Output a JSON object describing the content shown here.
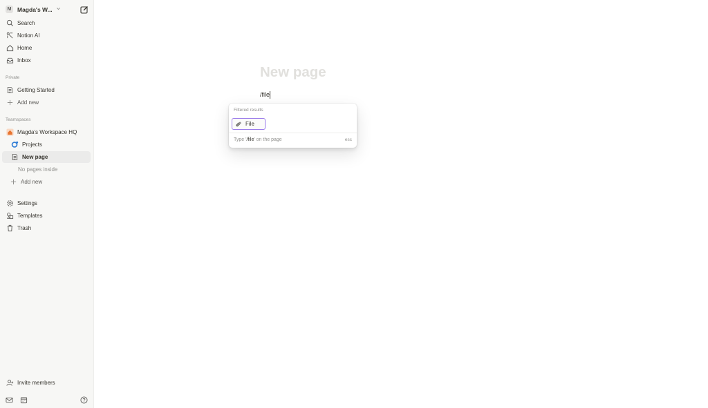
{
  "sidebar": {
    "workspace": {
      "badge": "M",
      "name": "Magda's W..."
    },
    "top_items": [
      {
        "label": "Search",
        "icon": "search-icon"
      },
      {
        "label": "Notion AI",
        "icon": "notion-ai-icon"
      },
      {
        "label": "Home",
        "icon": "home-icon"
      },
      {
        "label": "Inbox",
        "icon": "inbox-icon"
      }
    ],
    "private_label": "Private",
    "private_items": [
      {
        "label": "Getting Started",
        "icon": "page-icon"
      },
      {
        "label": "Add new",
        "icon": "plus-icon"
      }
    ],
    "teamspaces_label": "Teamspaces",
    "teamspace_items": [
      {
        "label": "Magda's Workspace HQ",
        "icon": "house-icon"
      },
      {
        "label": "Projects",
        "icon": "projects-icon"
      },
      {
        "label": "New page",
        "icon": "page-icon"
      },
      {
        "label": "No pages inside"
      },
      {
        "label": "Add new",
        "icon": "plus-icon"
      }
    ],
    "bottom_items": [
      {
        "label": "Settings",
        "icon": "gear-icon"
      },
      {
        "label": "Templates",
        "icon": "templates-icon"
      },
      {
        "label": "Trash",
        "icon": "trash-icon"
      }
    ],
    "invite": {
      "label": "Invite members",
      "icon": "invite-icon"
    }
  },
  "page": {
    "title_placeholder": "New page",
    "slash_input": "/file"
  },
  "menu": {
    "header": "Filtered results",
    "item": "File",
    "footer_pre": "Type '",
    "footer_cmd": "/file",
    "footer_post": "' on the page",
    "esc": "esc"
  },
  "colors": {
    "accent": "#9a7bea",
    "sidebar_bg": "#f7f7f5",
    "placeholder": "#e1e0dd"
  }
}
